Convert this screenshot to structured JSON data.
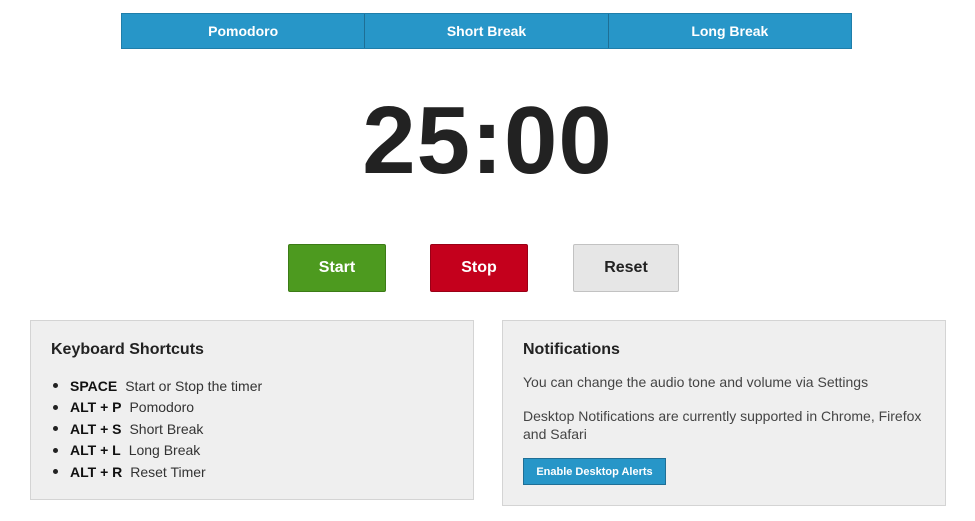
{
  "tabs": [
    {
      "label": "Pomodoro"
    },
    {
      "label": "Short Break"
    },
    {
      "label": "Long Break"
    }
  ],
  "timer": {
    "display": "25:00"
  },
  "controls": {
    "start_label": "Start",
    "stop_label": "Stop",
    "reset_label": "Reset"
  },
  "shortcuts_panel": {
    "title": "Keyboard Shortcuts",
    "items": [
      {
        "key": "SPACE",
        "desc": "Start or Stop the timer"
      },
      {
        "key": "ALT + P",
        "desc": "Pomodoro"
      },
      {
        "key": "ALT + S",
        "desc": "Short Break"
      },
      {
        "key": "ALT + L",
        "desc": "Long Break"
      },
      {
        "key": "ALT + R",
        "desc": "Reset Timer"
      }
    ]
  },
  "notifications_panel": {
    "title": "Notifications",
    "line1": "You can change the audio tone and volume via Settings",
    "line2": "Desktop Notifications are currently supported in Chrome, Firefox and Safari",
    "button_label": "Enable Desktop Alerts"
  },
  "colors": {
    "tab_bar": "#2796c8",
    "start": "#4d9a1f",
    "stop": "#c4001c",
    "reset": "#e6e6e6",
    "panel_bg": "#efefef"
  }
}
